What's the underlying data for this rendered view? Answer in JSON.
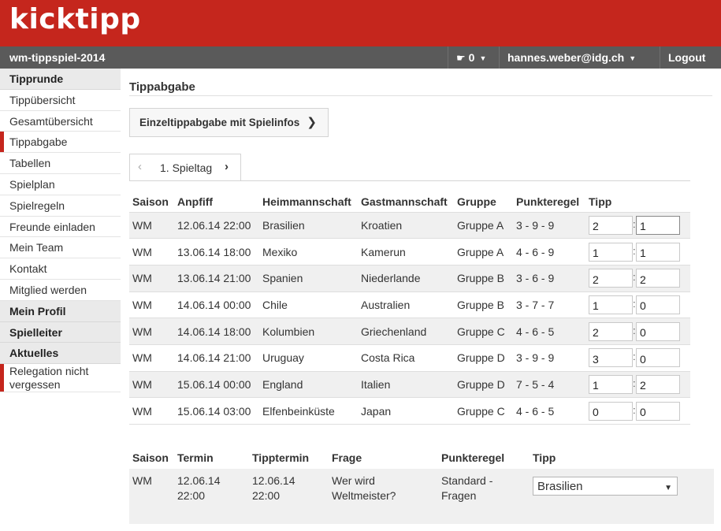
{
  "header": {
    "logo": "kicktipp"
  },
  "topbar": {
    "group_name": "wm-tippspiel-2014",
    "notifications": "0",
    "user": "hannes.weber@idg.ch",
    "logout": "Logout"
  },
  "sidebar": {
    "items": [
      {
        "label": "Tipprunde",
        "type": "head"
      },
      {
        "label": "Tippübersicht",
        "type": "item"
      },
      {
        "label": "Gesamtübersicht",
        "type": "item"
      },
      {
        "label": "Tippabgabe",
        "type": "active"
      },
      {
        "label": "Tabellen",
        "type": "item"
      },
      {
        "label": "Spielplan",
        "type": "item"
      },
      {
        "label": "Spielregeln",
        "type": "item"
      },
      {
        "label": "Freunde einladen",
        "type": "item"
      },
      {
        "label": "Mein Team",
        "type": "item"
      },
      {
        "label": "Kontakt",
        "type": "item"
      },
      {
        "label": "Mitglied werden",
        "type": "item"
      },
      {
        "label": "Mein Profil",
        "type": "head"
      },
      {
        "label": "Spielleiter",
        "type": "head"
      },
      {
        "label": "Aktuelles",
        "type": "head"
      }
    ],
    "news_line1": "Relegation nicht",
    "news_line2": "vergessen"
  },
  "main": {
    "title": "Tippabgabe",
    "single_button": "Einzeltippabgabe mit Spielinfos",
    "matchday": "1. Spieltag",
    "headers": [
      "Saison",
      "Anpfiff",
      "Heimmannschaft",
      "Gastmannschaft",
      "Gruppe",
      "Punkteregel",
      "Tipp"
    ],
    "matches": [
      {
        "saison": "WM",
        "anpfiff": "12.06.14 22:00",
        "heim": "Brasilien",
        "gast": "Kroatien",
        "gruppe": "Gruppe A",
        "regel": "3 - 9 - 9",
        "tipp_heim": "2",
        "tipp_gast": "1"
      },
      {
        "saison": "WM",
        "anpfiff": "13.06.14 18:00",
        "heim": "Mexiko",
        "gast": "Kamerun",
        "gruppe": "Gruppe A",
        "regel": "4 - 6 - 9",
        "tipp_heim": "1",
        "tipp_gast": "1"
      },
      {
        "saison": "WM",
        "anpfiff": "13.06.14 21:00",
        "heim": "Spanien",
        "gast": "Niederlande",
        "gruppe": "Gruppe B",
        "regel": "3 - 6 - 9",
        "tipp_heim": "2",
        "tipp_gast": "2"
      },
      {
        "saison": "WM",
        "anpfiff": "14.06.14 00:00",
        "heim": "Chile",
        "gast": "Australien",
        "gruppe": "Gruppe B",
        "regel": "3 - 7 - 7",
        "tipp_heim": "1",
        "tipp_gast": "0"
      },
      {
        "saison": "WM",
        "anpfiff": "14.06.14 18:00",
        "heim": "Kolumbien",
        "gast": "Griechenland",
        "gruppe": "Gruppe C",
        "regel": "4 - 6 - 5",
        "tipp_heim": "2",
        "tipp_gast": "0"
      },
      {
        "saison": "WM",
        "anpfiff": "14.06.14 21:00",
        "heim": "Uruguay",
        "gast": "Costa Rica",
        "gruppe": "Gruppe D",
        "regel": "3 - 9 - 9",
        "tipp_heim": "3",
        "tipp_gast": "0"
      },
      {
        "saison": "WM",
        "anpfiff": "15.06.14 00:00",
        "heim": "England",
        "gast": "Italien",
        "gruppe": "Gruppe D",
        "regel": "7 - 5 - 4",
        "tipp_heim": "1",
        "tipp_gast": "2"
      },
      {
        "saison": "WM",
        "anpfiff": "15.06.14 03:00",
        "heim": "Elfenbeinküste",
        "gast": "Japan",
        "gruppe": "Gruppe C",
        "regel": "4 - 6 - 5",
        "tipp_heim": "0",
        "tipp_gast": "0"
      }
    ],
    "question_headers": [
      "Saison",
      "Termin",
      "Tipptermin",
      "Frage",
      "Punkteregel",
      "Tipp"
    ],
    "question": {
      "saison": "WM",
      "termin_date": "12.06.14",
      "termin_time": "22:00",
      "tipptermin_date": "12.06.14",
      "tipptermin_time": "22:00",
      "frage_line1": "Wer wird",
      "frage_line2": "Weltmeister?",
      "regel_line1": "Standard -",
      "regel_line2": "Fragen",
      "tipp": "Brasilien"
    }
  },
  "colors": {
    "brand": "#c5261d",
    "topbar": "#5a5a5a"
  }
}
